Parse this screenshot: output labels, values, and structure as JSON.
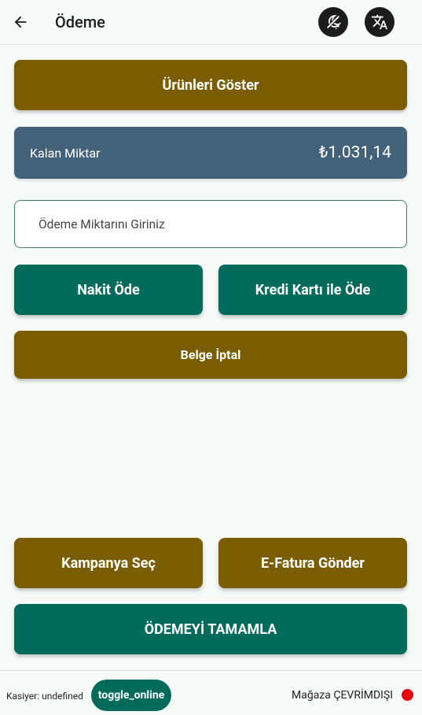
{
  "header": {
    "title": "Ödeme",
    "back_icon": "arrow-left-icon",
    "theme_icon": "dark-mode-off-icon",
    "language_icon": "translate-icon"
  },
  "buttons": {
    "show_products": "Ürünleri Göster",
    "pay_cash": "Nakit Öde",
    "pay_card": "Kredi Kartı ile Öde",
    "cancel_document": "Belge İptal",
    "select_campaign": "Kampanya Seç",
    "send_einvoice": "E-Fatura Gönder",
    "complete_payment": "ÖDEMEYİ TAMAMLA"
  },
  "remaining": {
    "label": "Kalan Miktar",
    "amount": "₺1.031,14"
  },
  "payment_input": {
    "placeholder": "Ödeme Miktarını Giriniz",
    "value": ""
  },
  "footer": {
    "cashier": "Kasiyer: undefined",
    "toggle_label": "toggle_online",
    "store_status": "Mağaza ÇEVRİMDIŞI",
    "status_color": "#e8000b"
  },
  "colors": {
    "gold": "#7a5d00",
    "teal": "#006b5b",
    "slate": "#44617a"
  }
}
